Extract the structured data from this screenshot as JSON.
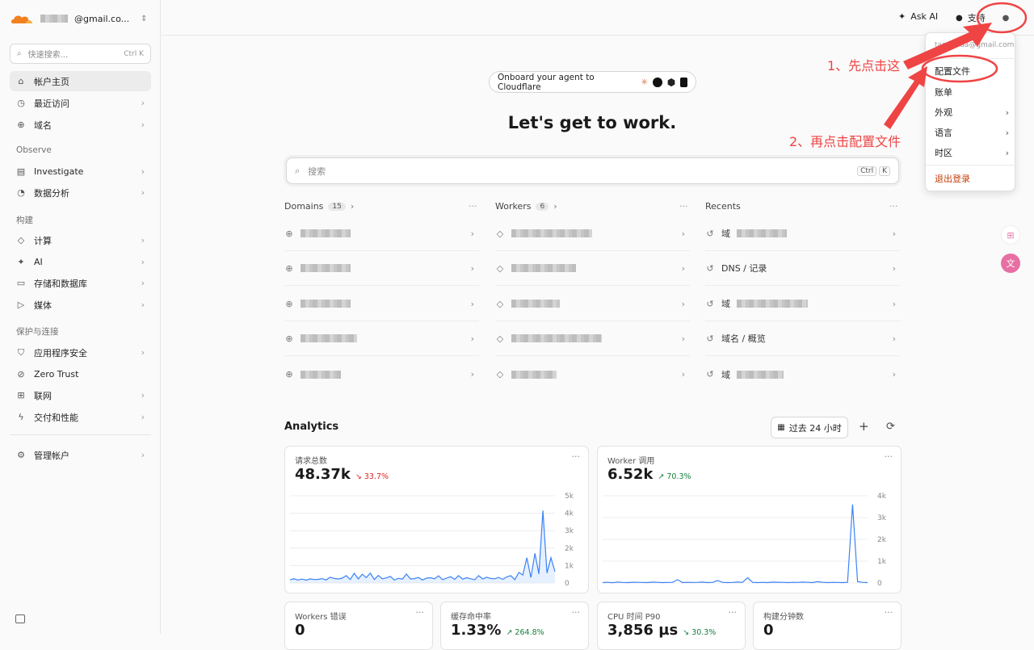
{
  "sidebar": {
    "account_email": "@gmail.co...",
    "search_placeholder": "快速搜索...",
    "search_shortcut": "Ctrl K",
    "items": [
      {
        "label": "帐户主页"
      },
      {
        "label": "最近访问"
      },
      {
        "label": "域名"
      },
      {
        "label": "Investigate"
      },
      {
        "label": "数据分析"
      },
      {
        "label": "计算"
      },
      {
        "label": "AI"
      },
      {
        "label": "存储和数据库"
      },
      {
        "label": "媒体"
      },
      {
        "label": "应用程序安全"
      },
      {
        "label": "Zero Trust"
      },
      {
        "label": "联网"
      },
      {
        "label": "交付和性能"
      },
      {
        "label": "管理帐户"
      }
    ],
    "sections": [
      "Observe",
      "构建",
      "保护与连接"
    ]
  },
  "topbar": {
    "ask_ai": "Ask AI",
    "support": "支持"
  },
  "onboard_label": "Onboard your agent to Cloudflare",
  "heading": "Let's get to work.",
  "main_search": {
    "placeholder": "搜索",
    "key1": "Ctrl",
    "key2": "K"
  },
  "columns": {
    "domains": {
      "title": "Domains",
      "count": "15"
    },
    "workers": {
      "title": "Workers",
      "count": "6"
    },
    "recents": {
      "title": "Recents"
    }
  },
  "recents": [
    {
      "label": "域"
    },
    {
      "label": "DNS / 记录"
    },
    {
      "label": "域"
    },
    {
      "label": "域名 / 概览"
    },
    {
      "label": "域"
    }
  ],
  "analytics": {
    "title": "Analytics",
    "range": "过去 24 小时",
    "cards": [
      {
        "title": "请求总数",
        "value": "48.37k",
        "delta": "↘ 33.7%",
        "delta_color": "#dc2626"
      },
      {
        "title": "Worker 调用",
        "value": "6.52k",
        "delta": "↗ 70.3%",
        "delta_color": "#15803d"
      }
    ],
    "small_cards": [
      {
        "title": "Workers 错误",
        "value": "0",
        "delta": ""
      },
      {
        "title": "缓存命中率",
        "value": "1.33%",
        "delta": "↗ 264.8%"
      },
      {
        "title": "CPU 时间 P90",
        "value": "3,856 µs",
        "delta": "↘ 30.3%"
      },
      {
        "title": "构建分钟数",
        "value": "0",
        "delta": ""
      }
    ]
  },
  "chart_data": [
    {
      "type": "area",
      "title": "请求总数",
      "y_ticks": [
        "5k",
        "4k",
        "3k",
        "2k",
        "1k",
        "0"
      ],
      "ylim": [
        0,
        5000
      ],
      "values": [
        180,
        240,
        170,
        220,
        160,
        230,
        200,
        210,
        250,
        170,
        330,
        260,
        230,
        280,
        420,
        200,
        560,
        230,
        500,
        310,
        560,
        200,
        430,
        240,
        290,
        380,
        170,
        270,
        220,
        510,
        230,
        250,
        320,
        170,
        280,
        300,
        240,
        410,
        190,
        280,
        360,
        210,
        420,
        220,
        300,
        240,
        190,
        420,
        230,
        330,
        260,
        240,
        320,
        210,
        350,
        420,
        190,
        600,
        460,
        1450,
        310,
        1700,
        520,
        4150,
        570,
        1450,
        650
      ]
    },
    {
      "type": "line",
      "title": "Worker 调用",
      "y_ticks": [
        "4k",
        "3k",
        "2k",
        "1k",
        "0"
      ],
      "ylim": [
        0,
        4000
      ],
      "values": [
        20,
        30,
        15,
        40,
        25,
        20,
        35,
        30,
        25,
        20,
        40,
        30,
        20,
        25,
        30,
        150,
        20,
        30,
        25,
        30,
        40,
        20,
        30,
        110,
        30,
        20,
        25,
        40,
        30,
        240,
        30,
        20,
        30,
        20,
        40,
        35,
        30,
        20,
        30,
        25,
        40,
        30,
        20,
        60,
        30,
        20,
        30,
        25,
        20,
        30,
        3600,
        60,
        30,
        20
      ]
    }
  ],
  "dropdown": {
    "email": "taoyouda@gmail.com",
    "items": [
      "配置文件",
      "账单",
      "外观",
      "语言",
      "时区"
    ],
    "logout": "退出登录"
  },
  "annotations": {
    "step1": "1、先点击这",
    "step2": "2、再点击配置文件"
  }
}
